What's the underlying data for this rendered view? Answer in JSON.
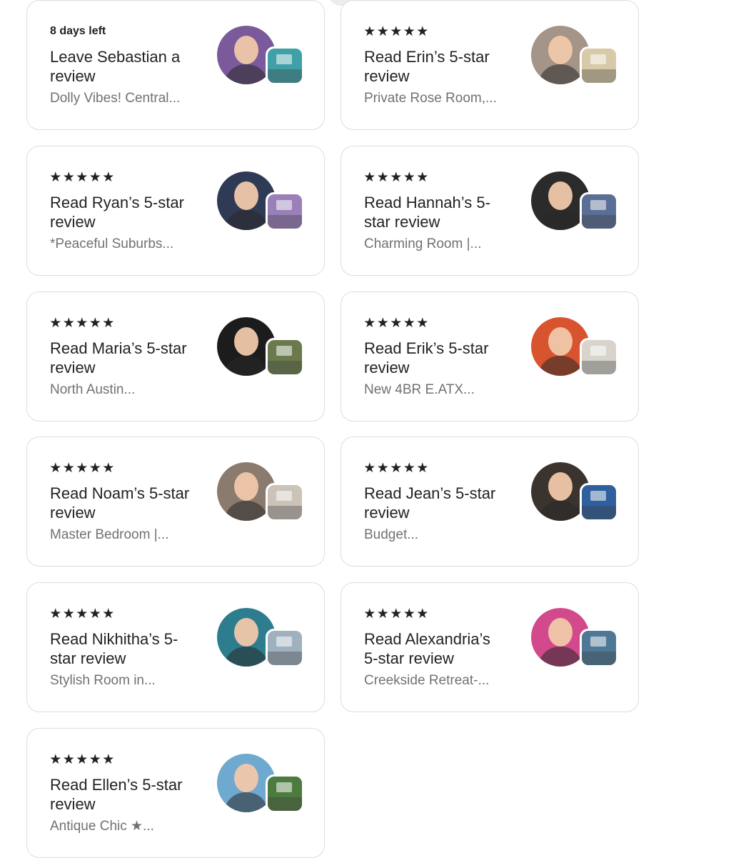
{
  "cards": [
    {
      "meta": "8 days left",
      "rating_stars": 0,
      "title": "Leave Sebastian a review",
      "subtitle": "Dolly Vibes! Central...",
      "avatar_color": "#7a5a9a",
      "thumb_color": "#3fa0a8"
    },
    {
      "meta": "",
      "rating_stars": 5,
      "title": "Read Erin’s 5-star review",
      "subtitle": "Private Rose Room,...",
      "avatar_color": "#a59488",
      "thumb_color": "#d8c9a8"
    },
    {
      "meta": "",
      "rating_stars": 5,
      "title": "Read Ryan’s 5-star review",
      "subtitle": "*Peaceful Suburbs...",
      "avatar_color": "#2f3a55",
      "thumb_color": "#9a7fb8"
    },
    {
      "meta": "",
      "rating_stars": 5,
      "title": "Read Hannah’s 5-star review",
      "subtitle": "Charming Room |...",
      "avatar_color": "#2b2b2b",
      "thumb_color": "#5a6e96"
    },
    {
      "meta": "",
      "rating_stars": 5,
      "title": "Read Maria’s 5-star review",
      "subtitle": "North Austin...",
      "avatar_color": "#1c1c1c",
      "thumb_color": "#6a7a4c"
    },
    {
      "meta": "",
      "rating_stars": 5,
      "title": "Read Erik’s 5-star review",
      "subtitle": "New 4BR E.ATX...",
      "avatar_color": "#d8542e",
      "thumb_color": "#d8d4cc"
    },
    {
      "meta": "",
      "rating_stars": 5,
      "title": "Read Noam’s 5-star review",
      "subtitle": "Master Bedroom |...",
      "avatar_color": "#8b7a6e",
      "thumb_color": "#cbc2b8"
    },
    {
      "meta": "",
      "rating_stars": 5,
      "title": "Read Jean’s 5-star review",
      "subtitle": "Budget...",
      "avatar_color": "#3a332e",
      "thumb_color": "#2f5f9c"
    },
    {
      "meta": "",
      "rating_stars": 5,
      "title": "Read Nikhitha’s 5-star review",
      "subtitle": "Stylish Room in...",
      "avatar_color": "#2e7d8e",
      "thumb_color": "#9fb0bf"
    },
    {
      "meta": "",
      "rating_stars": 5,
      "title": "Read Alexandria’s 5-star review",
      "subtitle": "Creekside Retreat-...",
      "avatar_color": "#d24a8c",
      "thumb_color": "#4f7896"
    },
    {
      "meta": "",
      "rating_stars": 5,
      "title": "Read Ellen’s 5-star review",
      "subtitle": "Antique Chic ★...",
      "avatar_color": "#6fa9cf",
      "thumb_color": "#4d7a3f"
    }
  ],
  "icons": {
    "star": "★"
  },
  "colors": {
    "text_primary": "#222222",
    "text_secondary": "#717171",
    "card_border": "#dddddd"
  }
}
